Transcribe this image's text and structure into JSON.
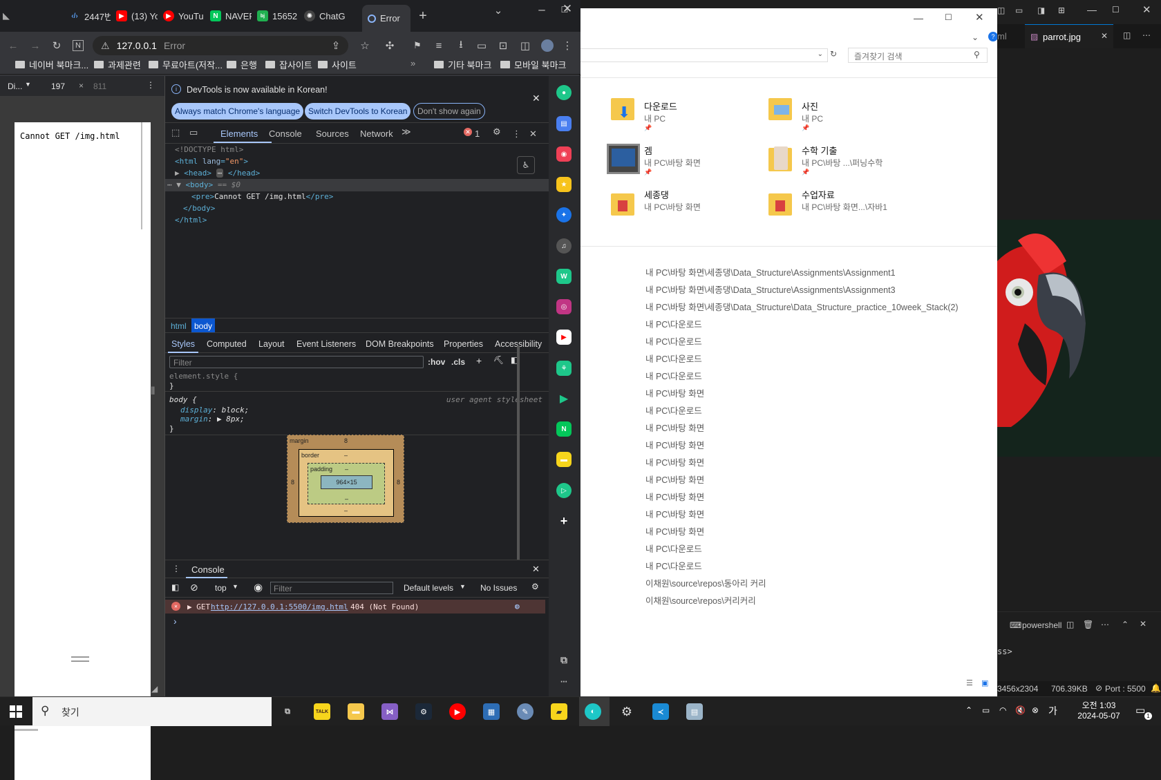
{
  "chrome": {
    "tabs": [
      {
        "label": "2447번",
        "icon": "code-icon"
      },
      {
        "label": "(13) Yo",
        "icon": "youtube-icon"
      },
      {
        "label": "YouTu",
        "icon": "youtube-icon"
      },
      {
        "label": "NAVER",
        "icon": "naver-icon"
      },
      {
        "label": "15652",
        "icon": "baekjoon-icon"
      },
      {
        "label": "ChatG",
        "icon": "chatgpt-icon"
      },
      {
        "label": "Error",
        "icon": "loading-icon"
      }
    ],
    "address": {
      "host": "127.0.0.1",
      "status": "Error"
    },
    "bookmarks": [
      "네이버 북마크...",
      "과제관련",
      "무료아트(저작...",
      "은행",
      "잡사이트",
      "사이트"
    ],
    "bookmarks_right": [
      "기타 북마크",
      "모바일 북마크"
    ]
  },
  "device_toolbar": {
    "device": "Di...",
    "width": "197",
    "height": "811"
  },
  "page": {
    "message": "Cannot GET /img.html"
  },
  "devtools": {
    "info": "DevTools is now available in Korean!",
    "buttons": [
      "Always match Chrome's language",
      "Switch DevTools to Korean",
      "Don't show again"
    ],
    "tabs": [
      "Elements",
      "Console",
      "Sources",
      "Network"
    ],
    "error_count": "1",
    "dom": {
      "doctype": "<!DOCTYPE html>",
      "html_open": "<html",
      "lang_attr": "lang",
      "lang_val": "\"en\"",
      "head": "<head>",
      "head_close": "</head>",
      "body_open": "<body>",
      "body_marker": "== $0",
      "pre_open": "<pre>",
      "pre_text": "Cannot GET /img.html",
      "pre_close": "</pre>",
      "body_close": "</body>",
      "html_close": "</html>"
    },
    "breadcrumbs": [
      "html",
      "body"
    ],
    "subtabs": [
      "Styles",
      "Computed",
      "Layout",
      "Event Listeners",
      "DOM Breakpoints",
      "Properties",
      "Accessibility"
    ],
    "filter_placeholder": "Filter",
    "hov": ":hov",
    "cls": ".cls",
    "rules": {
      "element_style": "element.style {",
      "close": "}",
      "body_selector": "body {",
      "source": "user agent stylesheet",
      "prop1": "display",
      "val1": "block",
      "prop2": "margin",
      "val2": "8px"
    },
    "boxmodel": {
      "margin": "margin",
      "border": "border",
      "padding": "padding",
      "content": "964×15",
      "margin_val": "8",
      "dash": "–"
    },
    "console": {
      "title": "Console",
      "context": "top",
      "filter_placeholder": "Filter",
      "levels": "Default levels",
      "issues": "No Issues",
      "error": {
        "method": "GET",
        "url": "http://127.0.0.1:5500/img.html",
        "status": "404 (Not Found)"
      },
      "prompt": "›"
    }
  },
  "explorer": {
    "search_placeholder": "즐겨찾기 검색",
    "quick_access": [
      {
        "name": "다운로드",
        "sub": "내 PC"
      },
      {
        "name": "사진",
        "sub": "내 PC"
      },
      {
        "name": "겜",
        "sub": "내 PC\\바탕 화면"
      },
      {
        "name": "수학 기출",
        "sub": "내 PC\\바탕 ...\\퍼닝수학"
      },
      {
        "name": "세종댕",
        "sub": "내 PC\\바탕 화면"
      },
      {
        "name": "수업자료",
        "sub": "내 PC\\바탕 화면...\\자바1"
      }
    ],
    "recent": [
      "내 PC\\바탕 화면\\세종댕\\Data_Structure\\Assignments\\Assignment1",
      "내 PC\\바탕 화면\\세종댕\\Data_Structure\\Assignments\\Assignment3",
      "내 PC\\바탕 화면\\세종댕\\Data_Structure\\Data_Structure_practice_10week_Stack(2)",
      "내 PC\\다운로드",
      "내 PC\\다운로드",
      "내 PC\\다운로드",
      "내 PC\\다운로드",
      "내 PC\\바탕 화면",
      "내 PC\\다운로드",
      "내 PC\\바탕 화면",
      "내 PC\\바탕 화면",
      "내 PC\\바탕 화면",
      "내 PC\\바탕 화면",
      "내 PC\\바탕 화면",
      "내 PC\\바탕 화면",
      "내 PC\\바탕 화면",
      "내 PC\\다운로드",
      "내 PC\\다운로드",
      "이채원\\source\\repos\\동아리 커리",
      "이채원\\source\\repos\\커리커리"
    ]
  },
  "vscode": {
    "tab_prev": "ml",
    "tab_active": "parrot.jpg",
    "terminal": "powershell",
    "terminal_text": "ss>",
    "status_dims": "3456x2304",
    "status_size": "706.39KB",
    "status_port": "Port : 5500"
  },
  "taskbar": {
    "search": "찾기",
    "time": "오전 1:03",
    "date": "2024-05-07",
    "notif": "1"
  }
}
